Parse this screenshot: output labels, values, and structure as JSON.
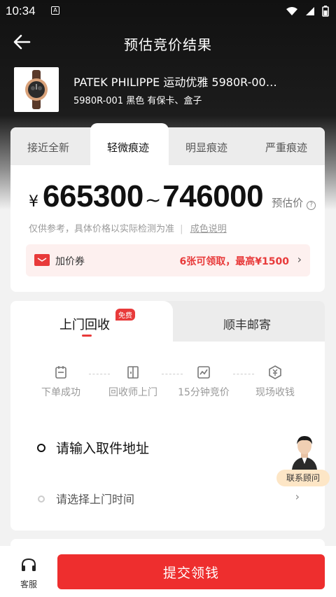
{
  "status_bar": {
    "time": "10:34",
    "indicator": "A"
  },
  "nav": {
    "title": "预估竞价结果",
    "back_icon": "arrow-left-icon"
  },
  "product": {
    "title": "PATEK PHILIPPE 运动优雅 5980R-00…",
    "subtitle": "5980R-001 黑色 有保卡、盒子"
  },
  "conditions": {
    "tabs": [
      "接近全新",
      "轻微痕迹",
      "明显痕迹",
      "严重痕迹"
    ],
    "active_index": 1
  },
  "price": {
    "currency": "¥",
    "low": "665300",
    "sep": "~",
    "high": "746000",
    "label": "预估价",
    "help": "?",
    "note": "仅供参考，具体价格以实际检测为准",
    "note_sep": "|",
    "note_link": "成色说明"
  },
  "coupon": {
    "label": "加价券",
    "info": "6张可领取，最高¥1500",
    "arrow": "›",
    "color": "#e83a3a"
  },
  "service_tabs": {
    "door": "上门回收",
    "door_badge": "免费",
    "mail": "顺丰邮寄"
  },
  "steps": [
    {
      "label": "下单成功",
      "icon": "order-icon"
    },
    {
      "label": "回收师上门",
      "icon": "door-icon"
    },
    {
      "label": "15分钟竞价",
      "icon": "chart-icon"
    },
    {
      "label": "现场收钱",
      "icon": "money-icon"
    }
  ],
  "pickup": {
    "address_label": "请输入取件地址",
    "time_label": "请选择上门时间",
    "time_arrow": "›"
  },
  "advisor": {
    "label": "联系顾问"
  },
  "bottom": {
    "service_label": "客服",
    "submit_label": "提交领钱",
    "accent": "#ee2e2e"
  }
}
